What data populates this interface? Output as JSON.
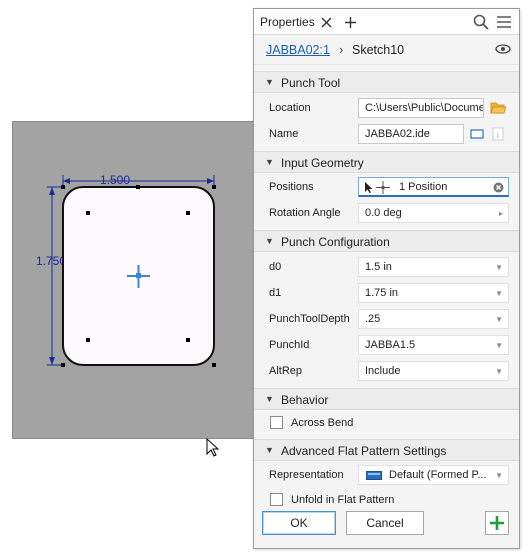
{
  "colors": {
    "dimension": "#1a2a9a",
    "center_mark": "#3a86d0",
    "sheet": "#a3a3a3",
    "add_button": "#1e9e3a",
    "link": "#1a5fb0"
  },
  "sketch": {
    "dim_width": "1.500",
    "dim_height": "1.750"
  },
  "panel": {
    "tab_label": "Properties",
    "breadcrumb_part": "JABBA02:1",
    "breadcrumb_sketch": "Sketch10",
    "sections": {
      "punch_tool": "Punch Tool",
      "input_geometry": "Input Geometry",
      "punch_configuration": "Punch Configuration",
      "behavior": "Behavior",
      "advanced": "Advanced Flat Pattern Settings"
    },
    "punch_tool": {
      "location_label": "Location",
      "location_value": "C:\\Users\\Public\\Documer",
      "name_label": "Name",
      "name_value": "JABBA02.ide"
    },
    "input_geometry": {
      "positions_label": "Positions",
      "positions_value": "1 Position",
      "rotation_label": "Rotation Angle",
      "rotation_value": "0.0 deg"
    },
    "config": [
      {
        "label": "d0",
        "value": "1.5 in"
      },
      {
        "label": "d1",
        "value": "1.75 in"
      },
      {
        "label": "PunchToolDepth",
        "value": ".25"
      },
      {
        "label": "PunchId",
        "value": "JABBA1.5"
      },
      {
        "label": "AltRep",
        "value": "Include"
      }
    ],
    "behavior": {
      "across_bend": "Across Bend"
    },
    "advanced": {
      "representation_label": "Representation",
      "representation_value": "Default (Formed P...",
      "unfold_label": "Unfold in Flat Pattern"
    },
    "buttons": {
      "ok": "OK",
      "cancel": "Cancel",
      "add": "+"
    }
  }
}
